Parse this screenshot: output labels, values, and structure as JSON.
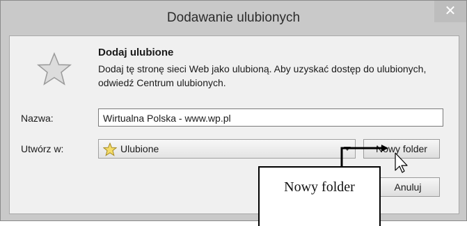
{
  "window": {
    "title": "Dodawanie ulubionych",
    "close_glyph": "✕"
  },
  "header": {
    "icon": "favorite-star-icon",
    "heading": "Dodaj ulubione",
    "description": "Dodaj tę stronę sieci Web jako ulubioną. Aby uzyskać dostęp do ulubionych, odwiedź Centrum ulubionych."
  },
  "form": {
    "name_label": "Nazwa:",
    "name_value": "Wirtualna Polska - www.wp.pl",
    "create_in_label": "Utwórz w:",
    "create_in_value": "Ulubione",
    "create_in_icon": "favorites-folder-star-icon"
  },
  "buttons": {
    "new_folder": "Nowy folder",
    "cancel": "Anuluj"
  },
  "annotation": {
    "callout_text": "Nowy folder"
  },
  "colors": {
    "frame": "#c9c9c9",
    "client": "#f0f0f0",
    "accent_star": "#d8d8d8"
  }
}
